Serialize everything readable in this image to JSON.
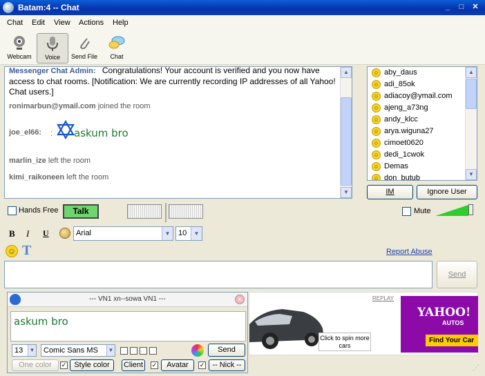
{
  "window": {
    "title": "Batam:4 -- Chat"
  },
  "menu": [
    "Chat",
    "Edit",
    "View",
    "Actions",
    "Help"
  ],
  "toolbar": [
    {
      "label": "Webcam",
      "icon": "webcam-icon"
    },
    {
      "label": "Voice",
      "icon": "microphone-icon"
    },
    {
      "label": "Send File",
      "icon": "paperclip-icon"
    },
    {
      "label": "Chat",
      "icon": "chat-bubble-icon"
    }
  ],
  "chat": {
    "admin_name": "Messenger Chat Admin:",
    "admin_message": "Congratulations! Your account is verified and you now have access to chat rooms. [Notification: We are currently recording IP addresses of all Yahoo! Chat users.]",
    "events": [
      {
        "user": "ronimarbun@ymail.com",
        "action": "joined the room"
      },
      {
        "user": "marlin_ize",
        "action": "left the room"
      },
      {
        "user": "kimi_raikoneen",
        "action": "left the room"
      }
    ],
    "message_user": "joe_el66:",
    "message_sep": ":",
    "message_text": "askum bro"
  },
  "users": [
    "aby_daus",
    "adi_85ok",
    "adiacoy@ymail.com",
    "ajeng_a73ng",
    "andy_klcc",
    "arya.wiguna27",
    "cimoet0620",
    "dedi_1cwok",
    "Demas",
    "don_butub"
  ],
  "userlist_buttons": {
    "im": "IM",
    "ignore": "Ignore User"
  },
  "voice": {
    "hands_free": "Hands Free",
    "talk": "Talk",
    "mute": "Mute"
  },
  "format": {
    "font": "Arial",
    "size": "10",
    "bold": "B",
    "italic": "I",
    "underline": "U"
  },
  "report_abuse": "Report Abuse",
  "send": "Send",
  "vn1": {
    "title": "--- VN1 xn--sowa VN1 ---",
    "text": "askum bro",
    "size": "13",
    "font": "Comic Sans MS",
    "send": "Send",
    "buttons": {
      "one_color": "One color",
      "style_color": "Style color",
      "client": "Client",
      "avatar": "Avatar",
      "nick": "-- Nick --"
    }
  },
  "ad": {
    "replay": "REPLAY",
    "spin": "Click to spin more cars",
    "brand": "YAHOO!",
    "autos": "AUTOS",
    "cta": "Find Your Car"
  },
  "colors": {
    "title_bar": "#0a3cb6",
    "talk": "#6fd66f",
    "accent": "#3b5998",
    "ad_purple": "#8b0aa8"
  }
}
